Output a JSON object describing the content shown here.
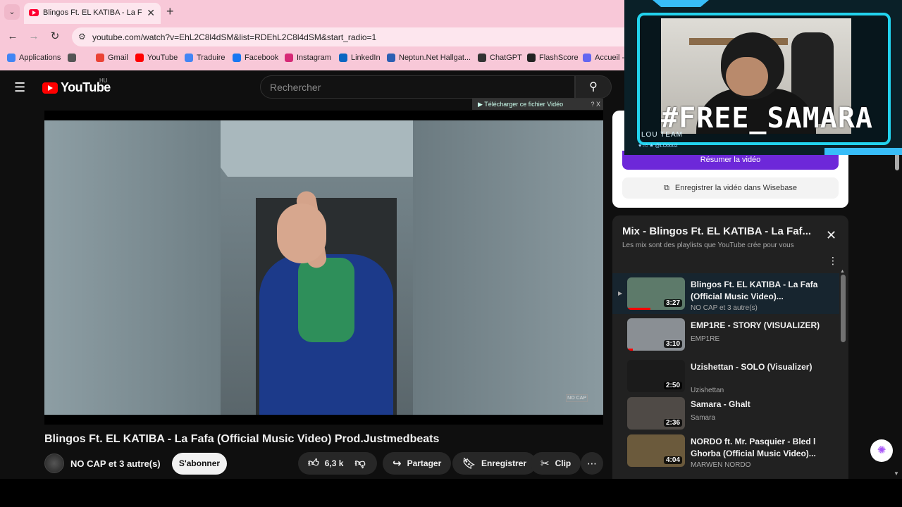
{
  "browser": {
    "tab_title": "Blingos Ft. EL KATIBA - La Fafa",
    "url": "youtube.com/watch?v=EhL2C8l4dSM&list=RDEhL2C8l4dSM&start_radio=1",
    "bookmarks": [
      {
        "label": "Applications",
        "icon": "grid-icon"
      },
      {
        "label": "",
        "icon": "extensions-icon"
      },
      {
        "label": "Gmail",
        "icon": "gmail-icon"
      },
      {
        "label": "YouTube",
        "icon": "youtube-icon"
      },
      {
        "label": "Traduire",
        "icon": "translate-icon"
      },
      {
        "label": "Facebook",
        "icon": "facebook-icon"
      },
      {
        "label": "Instagram",
        "icon": "instagram-icon"
      },
      {
        "label": "LinkedIn",
        "icon": "linkedin-icon"
      },
      {
        "label": "Neptun.Net Hallgat...",
        "icon": "neptun-icon"
      },
      {
        "label": "ChatGPT",
        "icon": "chatgpt-icon"
      },
      {
        "label": "FlashScore",
        "icon": "flashscore-icon"
      },
      {
        "label": "Accueil -",
        "icon": "accueil-icon"
      }
    ]
  },
  "youtube": {
    "logo_text": "YouTube",
    "country_code": "HU",
    "search_placeholder": "Rechercher",
    "download_bar": "Télécharger ce fichier Vidéo",
    "download_bar_controls": "? X",
    "video_watermark": "NO CAP",
    "video_title": "Blingos Ft. EL KATIBA - La Fafa (Official Music Video) Prod.Justmedbeats",
    "channel_name": "NO CAP et 3 autre(s)",
    "subscribe_label": "S'abonner",
    "likes": "6,3 k",
    "share_label": "Partager",
    "save_label": "Enregistrer",
    "clip_label": "Clip",
    "more_glyph": "⋯"
  },
  "wisebase": {
    "summary_button": "Résumer la vidéo",
    "save_button": "Enregistrer la vidéo dans Wisebase"
  },
  "playlist": {
    "title": "Mix - Blingos Ft. EL KATIBA - La Faf...",
    "subtitle": "Les mix sont des playlists que YouTube crée pour vous",
    "items": [
      {
        "title": "Blingos Ft. EL KATIBA - La Fafa (Official Music Video)...",
        "artist": "NO CAP et 3 autre(s)",
        "duration": "3:27",
        "active": true,
        "thumb_color": "#5d7a6a",
        "progress": 0.4
      },
      {
        "title": "EMP1RE - STORY (VISUALIZER)",
        "artist": "EMP1RE",
        "duration": "3:10",
        "active": false,
        "thumb_color": "#8a8f94",
        "progress": 0.1
      },
      {
        "title": "Uzishettan - SOLO (Visualizer)",
        "artist": "Uzishettan",
        "duration": "2:50",
        "active": false,
        "thumb_color": "#1b1b1b",
        "progress": 0
      },
      {
        "title": "Samara - Ghalt",
        "artist": "Samara",
        "duration": "2:36",
        "active": false,
        "thumb_color": "#4f4a46",
        "progress": 0
      },
      {
        "title": "NORDO ft. Mr. Pasquier - Bled l Ghorba (Official Music Video)...",
        "artist": "MARWEN NORDO",
        "duration": "4:04",
        "active": false,
        "thumb_color": "#6b5a3c",
        "progress": 0
      }
    ]
  },
  "webcam": {
    "hashtag": "#FREE_SAMARA",
    "team": "LOU TEAM",
    "social": "@LOoou2"
  },
  "colors": {
    "chrome_bg": "#f8c8d8",
    "yt_red": "#ff0000",
    "wisebase_purple": "#6d28d9",
    "overlay_cyan": "#22d3ee"
  }
}
